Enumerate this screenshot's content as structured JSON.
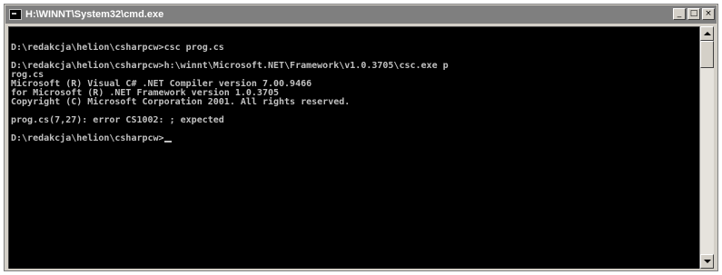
{
  "window": {
    "title": "H:\\WINNT\\System32\\cmd.exe",
    "buttons": {
      "minimize_glyph": "_",
      "maximize_glyph": "□",
      "close_glyph": "×"
    }
  },
  "console": {
    "lines": [
      "D:\\redakcja\\helion\\csharpcw>csc prog.cs",
      "",
      "D:\\redakcja\\helion\\csharpcw>h:\\winnt\\Microsoft.NET\\Framework\\v1.0.3705\\csc.exe p",
      "rog.cs",
      "Microsoft (R) Visual C# .NET Compiler version 7.00.9466",
      "for Microsoft (R) .NET Framework version 1.0.3705",
      "Copyright (C) Microsoft Corporation 2001. All rights reserved.",
      "",
      "prog.cs(7,27): error CS1002: ; expected",
      "",
      "D:\\redakcja\\helion\\csharpcw>"
    ]
  },
  "colors": {
    "console_bg": "#000000",
    "console_text": "#c0c0c0",
    "titlebar_bg": "#7f7f7f",
    "frame": "#d4d0c8"
  },
  "icons": {
    "window_icon": "cmd-icon",
    "scroll_up": "arrow-up-icon",
    "scroll_down": "arrow-down-icon"
  }
}
